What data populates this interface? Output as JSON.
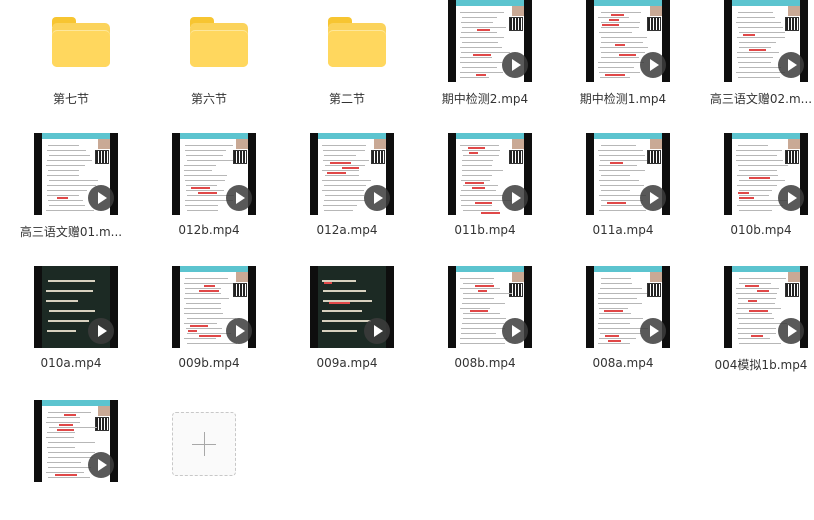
{
  "items": [
    {
      "type": "folder",
      "name": "第七节"
    },
    {
      "type": "folder",
      "name": "第六节"
    },
    {
      "type": "folder",
      "name": "第二节"
    },
    {
      "type": "video",
      "name": "期中检测2.mp4",
      "thumb": "doc"
    },
    {
      "type": "video",
      "name": "期中检测1.mp4",
      "thumb": "doc"
    },
    {
      "type": "video",
      "name": "高三语文赠02.m...",
      "thumb": "doc"
    },
    {
      "type": "video",
      "name": "高三语文赠01.m...",
      "thumb": "doc"
    },
    {
      "type": "video",
      "name": "012b.mp4",
      "thumb": "doc"
    },
    {
      "type": "video",
      "name": "012a.mp4",
      "thumb": "doc"
    },
    {
      "type": "video",
      "name": "011b.mp4",
      "thumb": "doc"
    },
    {
      "type": "video",
      "name": "011a.mp4",
      "thumb": "doc"
    },
    {
      "type": "video",
      "name": "010b.mp4",
      "thumb": "doc"
    },
    {
      "type": "video",
      "name": "010a.mp4",
      "thumb": "board"
    },
    {
      "type": "video",
      "name": "009b.mp4",
      "thumb": "doc"
    },
    {
      "type": "video",
      "name": "009a.mp4",
      "thumb": "board"
    },
    {
      "type": "video",
      "name": "008b.mp4",
      "thumb": "doc"
    },
    {
      "type": "video",
      "name": "008a.mp4",
      "thumb": "doc"
    },
    {
      "type": "video",
      "name": "004模拟1b.mp4",
      "thumb": "doc"
    },
    {
      "type": "video",
      "name": "",
      "thumb": "doc"
    },
    {
      "type": "add",
      "name": ""
    }
  ],
  "icons": {
    "folder": "folder-icon",
    "play": "play-icon",
    "add": "plus-icon"
  },
  "colors": {
    "folder": "#ffd75e",
    "accent": "#5cc4cf",
    "label": "#333333"
  }
}
